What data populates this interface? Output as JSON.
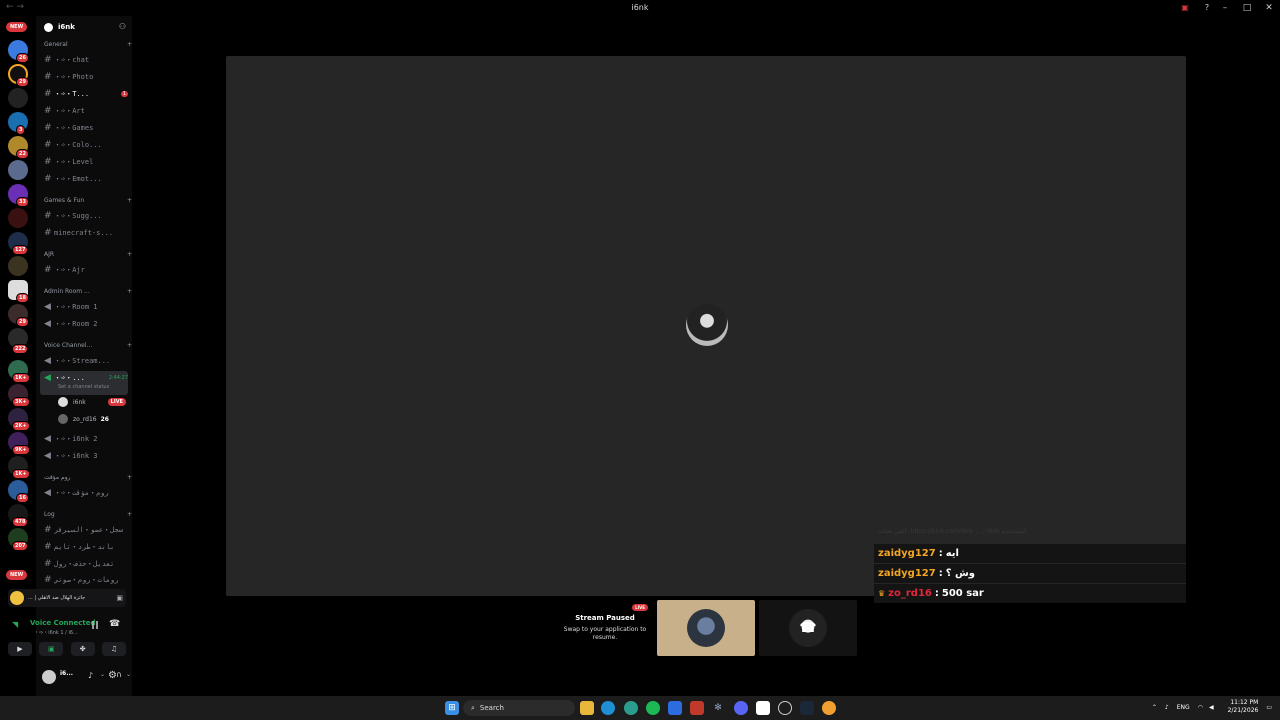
{
  "window": {
    "title": "i6nk"
  },
  "rail": {
    "new_top": "NEW",
    "new_bottom": "NEW",
    "badges": [
      "26",
      "29",
      "3",
      "22",
      "33",
      "127",
      "18",
      "29",
      "222",
      "1K+",
      "3K+",
      "2K+",
      "9K+",
      "1K+",
      "16",
      "478",
      "207"
    ]
  },
  "guild": {
    "name": "i6nk"
  },
  "categories": {
    "general": "General",
    "games_fun": "Games & Fun",
    "ajr": "AJR",
    "admin": "Admin Room ...",
    "voice": "Voice Channel...",
    "rooms": "روم مؤقت",
    "log": "Log"
  },
  "channels": {
    "chat": "・➩・chat",
    "photo": "・➩・Photo",
    "t": "・➩・T...",
    "t_mentions": "1",
    "art": "・➩・Art",
    "games": "・➩・Games",
    "colo": "・➩・Colo...",
    "level": "・➩・Level",
    "emot": "・➩・Emot...",
    "sugg": "・➩・Sugg...",
    "minecraft": "minecraft-s...",
    "ajr": "・➩・Ajr",
    "room1": "・➩・Room 1",
    "room2": "・➩・Room 2",
    "stream": "・➩・Stream...",
    "current": "・➩・...",
    "current_time": "2:44:27",
    "current_status": "Set a channel status",
    "i6nk2": "・➩・i6nk 2",
    "i6nk3": "・➩・i6nk 3",
    "temp": "・➩・روم・مؤقت",
    "log1": "سجل・عضو・السيرفر",
    "log2": "باند・طرد・تايم",
    "log3": "تعديل・حذف・رول",
    "log4": "رومات・روم・صوتي"
  },
  "voice_users": [
    {
      "name": "i6nk",
      "badge": "LIVE"
    },
    {
      "name": "zo_rd16",
      "badge": "26"
    }
  ],
  "activity": {
    "text": "... | جائزة الهلال ضد الأهلي"
  },
  "voice_connected": {
    "status": "Voice Connected",
    "sub": "・➩・i6nk 1 / i6..."
  },
  "user": {
    "name": "i6..."
  },
  "chat_overlay": {
    "faded": "اكس تشات: https://kick.com/i6nk ... / i6nk المستخدم",
    "lines": [
      {
        "user": "zaidyg127",
        "message": "ايه",
        "crown": false
      },
      {
        "user": "zaidyg127",
        "message": "وش ؟",
        "crown": false
      },
      {
        "user": "zo_rd16",
        "message": "500 sar",
        "crown": true
      }
    ]
  },
  "stream_paused": {
    "live": "LIVE",
    "title": "Stream Paused",
    "subtitle": "Swap to your application to resume."
  },
  "taskbar": {
    "search": "Search",
    "lang": "ENG",
    "time": "11:12 PM",
    "date": "2/21/2026"
  },
  "colors": {
    "accent_red": "#da373c",
    "online_green": "#23a55a",
    "chat_orange": "#f5a623",
    "chat_red": "#e0283a"
  }
}
